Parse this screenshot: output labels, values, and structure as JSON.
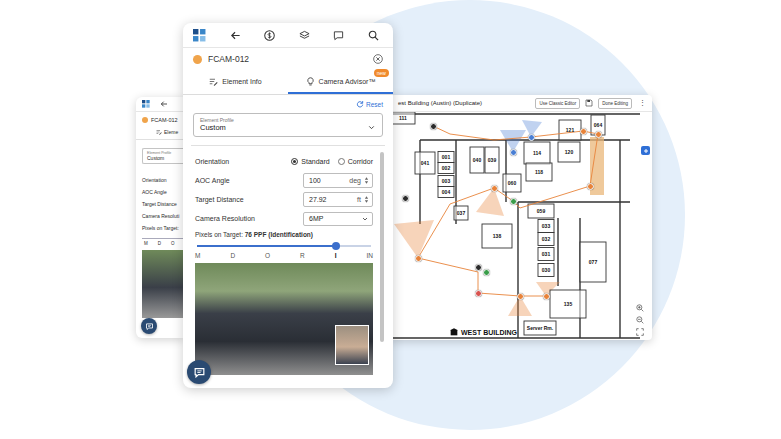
{
  "back_panel": {
    "title": "FCAM-012",
    "tab": "Eleme",
    "profile": {
      "label": "Element Profile",
      "value": "Custom"
    },
    "rows": [
      "Orientation",
      "AOC Angle",
      "Target Distance",
      "Camera Resoluti"
    ],
    "pixels_label": "Pixels on Target:",
    "scale": [
      "M",
      "D",
      "O"
    ]
  },
  "panel": {
    "title": "FCAM-012",
    "tabs": [
      {
        "label": "Element Info",
        "selected": false
      },
      {
        "label": "Camera Advisor™",
        "selected": true,
        "badge": "new"
      }
    ],
    "reset": "Reset",
    "profile": {
      "label": "Element Profile",
      "value": "Custom"
    },
    "orientation": {
      "label": "Orientation",
      "options": [
        {
          "label": "Standard",
          "selected": true
        },
        {
          "label": "Corridor",
          "selected": false
        }
      ]
    },
    "fields": [
      {
        "label": "AOC Angle",
        "value": "100",
        "unit": "deg",
        "kind": "number"
      },
      {
        "label": "Target Distance",
        "value": "27.92",
        "unit": "ft",
        "kind": "number"
      },
      {
        "label": "Camera Resolution",
        "value": "6MP",
        "kind": "select"
      }
    ],
    "pixels": {
      "label": "Pixels on Target:",
      "value": "76 PPF (Identification)"
    },
    "slider": {
      "level": 0.8
    },
    "scale": [
      {
        "label": "M",
        "selected": false
      },
      {
        "label": "D",
        "selected": false
      },
      {
        "label": "O",
        "selected": false
      },
      {
        "label": "R",
        "selected": false
      },
      {
        "label": "I",
        "selected": true
      },
      {
        "label": "IN",
        "selected": false
      }
    ]
  },
  "map": {
    "title": "est Building (Austin) (Duplicate)",
    "buttons": [
      "Use Classic Editor",
      "Done Editing"
    ],
    "more": "⋮",
    "rooms": [
      "111",
      "121",
      "064",
      "041",
      "001",
      "002",
      "040",
      "039",
      "114",
      "120",
      "003",
      "118",
      "060",
      "004",
      "037",
      "059",
      "138",
      "033",
      "032",
      "031",
      "030",
      "077",
      "135",
      "Server Rm."
    ],
    "building_label": "WEST BUILDING",
    "cameras": [
      {
        "color": "#2b2b2b"
      },
      {
        "color": "#4a7fd4"
      },
      {
        "color": "#4a7fd4"
      },
      {
        "color": "#e8833a"
      },
      {
        "color": "#e8833a"
      },
      {
        "color": "#2b2b2b"
      },
      {
        "color": "#e8833a"
      },
      {
        "color": "#3a9d4a"
      },
      {
        "color": "#e8833a"
      },
      {
        "color": "#2b2b2b"
      },
      {
        "color": "#3a9d4a"
      },
      {
        "color": "#d9534f"
      },
      {
        "color": "#e8833a"
      },
      {
        "color": "#e8833a"
      },
      {
        "color": "#e8833a"
      }
    ]
  }
}
